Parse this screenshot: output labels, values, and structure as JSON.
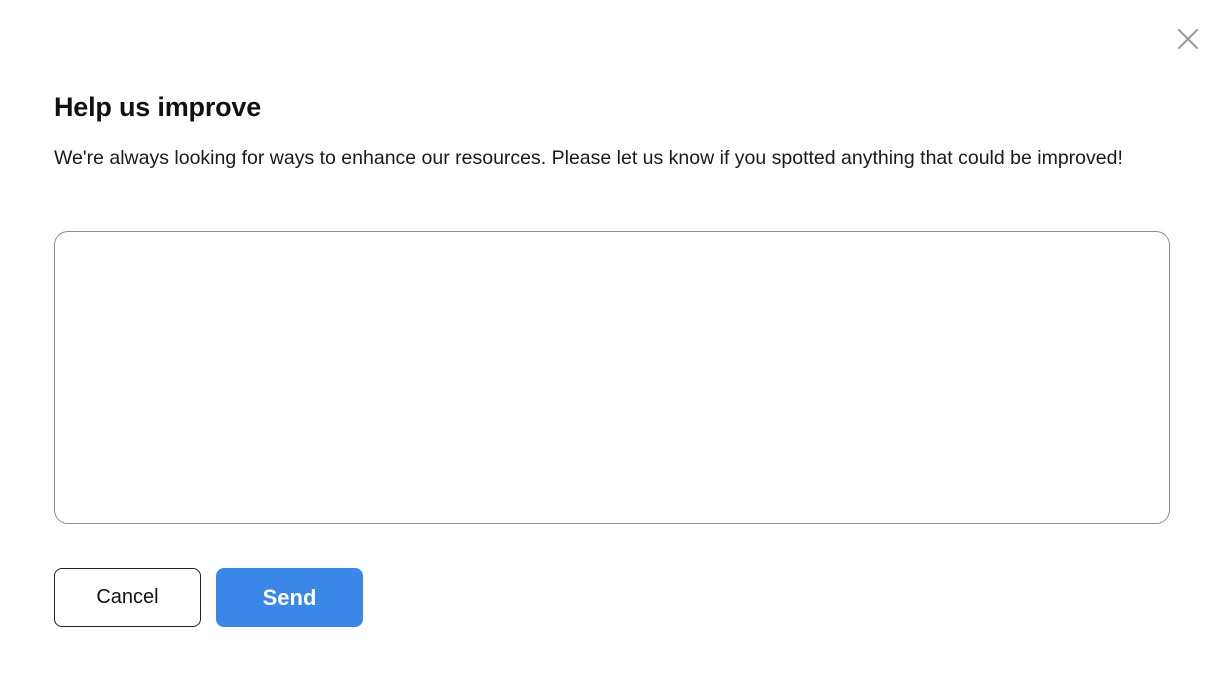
{
  "dialog": {
    "title": "Help us improve",
    "description": "We're always looking for ways to enhance our resources. Please let us know if you spotted anything that could be improved!",
    "feedback": {
      "value": "",
      "placeholder": ""
    },
    "close_icon": "close-icon",
    "buttons": {
      "cancel_label": "Cancel",
      "send_label": "Send"
    }
  },
  "colors": {
    "primary": "#3b87e8",
    "border": "#8e8e8e",
    "text": "#111111",
    "close_icon": "#9a9a9a"
  }
}
